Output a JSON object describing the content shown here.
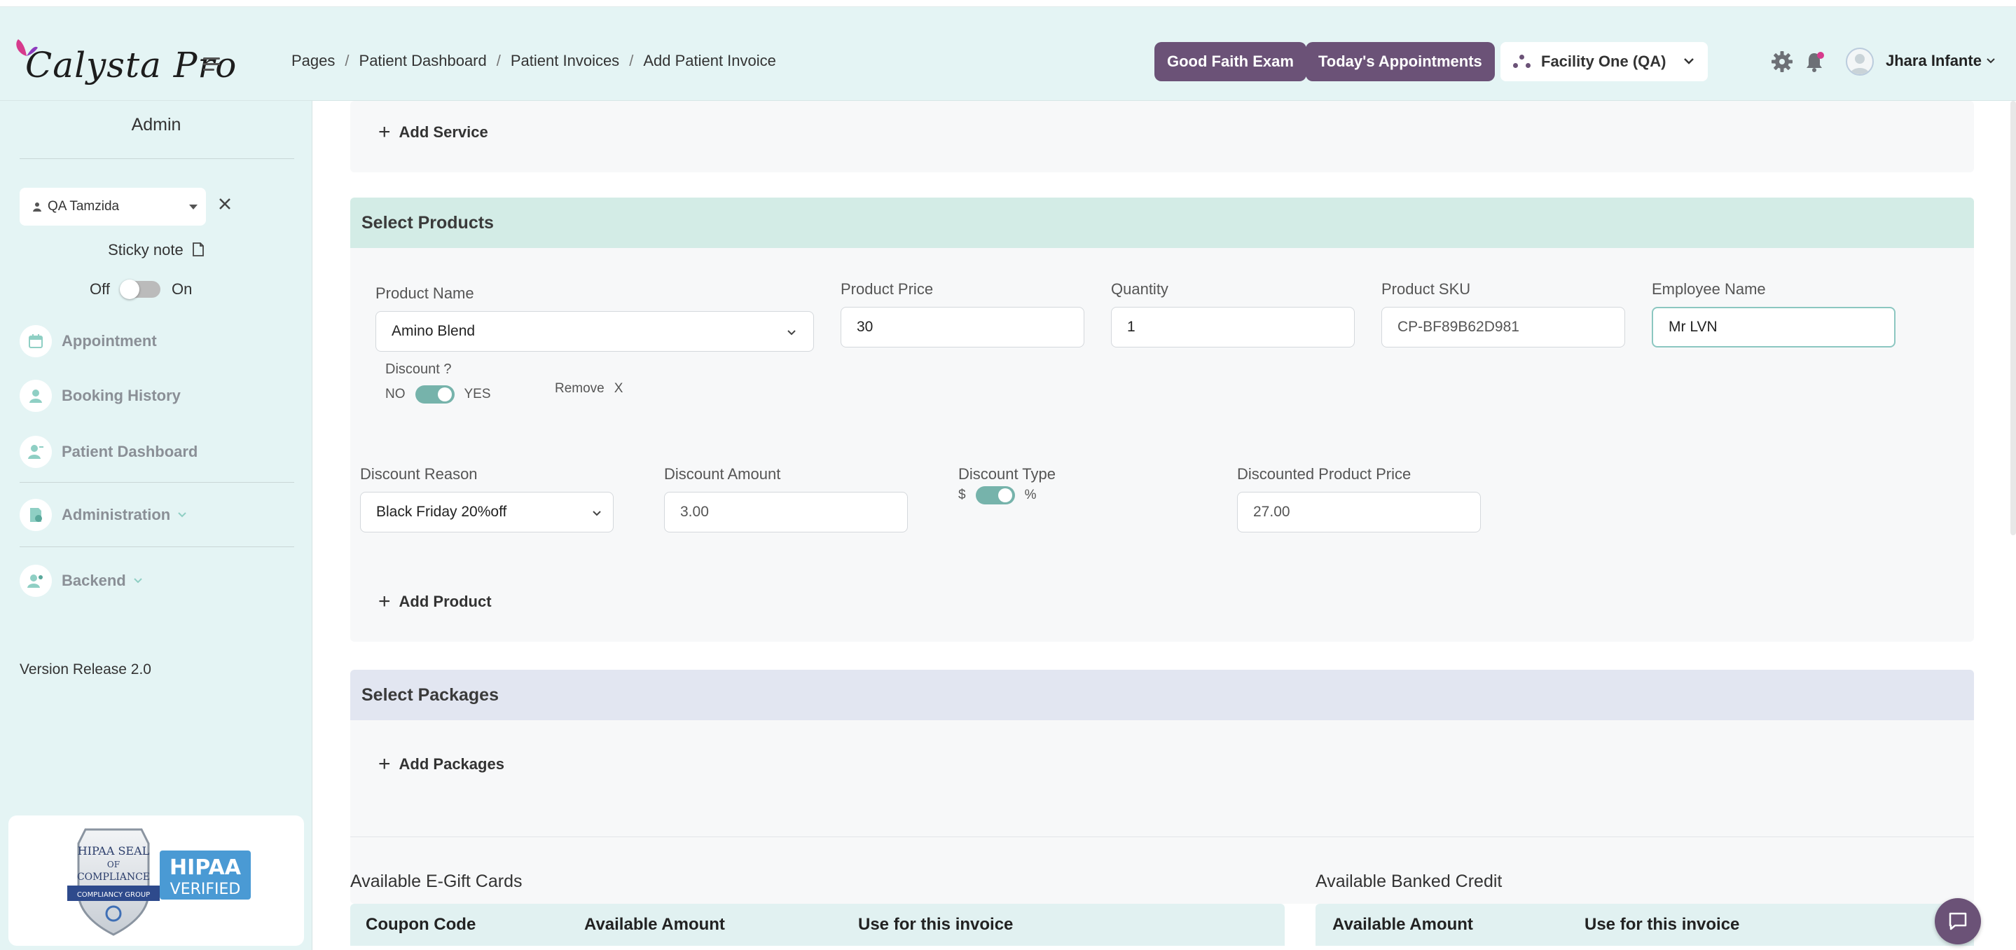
{
  "header": {
    "logo_text": "Calysta Pro",
    "breadcrumb": [
      "Pages",
      "Patient Dashboard",
      "Patient Invoices",
      "Add Patient Invoice"
    ],
    "good_faith_button": "Good Faith Exam",
    "todays_appointments_button": "Today's Appointments",
    "facility": "Facility One (QA)",
    "user_name": "Jhara Infante"
  },
  "sidebar": {
    "role": "Admin",
    "patient": "QA Tamzida",
    "sticky_note": "Sticky note",
    "toggle_off": "Off",
    "toggle_on": "On",
    "items": [
      {
        "label": "Appointment"
      },
      {
        "label": "Booking History"
      },
      {
        "label": "Patient Dashboard"
      },
      {
        "label": "Administration"
      },
      {
        "label": "Backend"
      }
    ],
    "version": "Version Release 2.0",
    "hipaa": {
      "seal_text": "HIPAA SEAL OF COMPLIANCE",
      "group_text": "COMPLIANCY GROUP",
      "verified_line1": "HIPAA",
      "verified_line2": "VERIFIED"
    }
  },
  "services": {
    "add_label": "Add Service"
  },
  "products": {
    "title": "Select Products",
    "product_name_label": "Product Name",
    "product_name_value": "Amino Blend",
    "product_price_label": "Product Price",
    "product_price_value": "30",
    "quantity_label": "Quantity",
    "quantity_value": "1",
    "sku_label": "Product SKU",
    "sku_value": "CP-BF89B62D981",
    "employee_label": "Employee Name",
    "employee_value": "Mr LVN",
    "discount_label": "Discount ?",
    "discount_no": "NO",
    "discount_yes": "YES",
    "remove_label": "Remove",
    "remove_x": "X",
    "discount_reason_label": "Discount Reason",
    "discount_reason_value": "Black Friday 20%off",
    "discount_amount_label": "Discount Amount",
    "discount_amount_value": "3.00",
    "discount_type_label": "Discount Type",
    "discount_type_dollar": "$",
    "discount_type_percent": "%",
    "discounted_price_label": "Discounted Product Price",
    "discounted_price_value": "27.00",
    "add_label": "Add Product"
  },
  "packages": {
    "title": "Select Packages",
    "add_label": "Add Packages"
  },
  "egift": {
    "title": "Available E-Gift Cards",
    "columns": [
      "Coupon Code",
      "Available Amount",
      "Use for this invoice"
    ]
  },
  "banked": {
    "title": "Available Banked Credit",
    "columns": [
      "Available Amount",
      "Use for this invoice"
    ]
  },
  "colors": {
    "brand_purple": "#6b5277",
    "mint_bg": "#e4f4f4",
    "products_header": "#d3ece6",
    "packages_header": "#e2e6f1",
    "toggle_teal": "#76b3ab"
  }
}
